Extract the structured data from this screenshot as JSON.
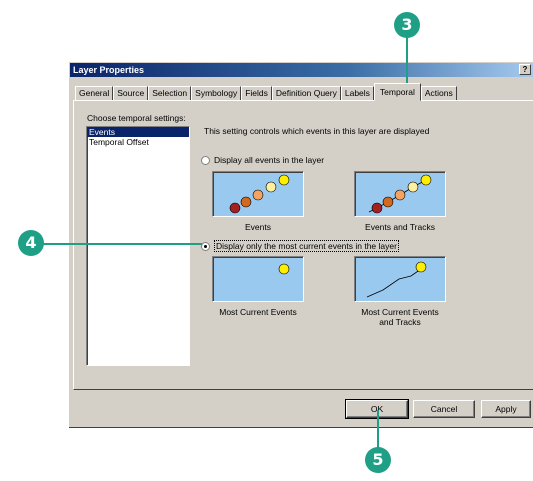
{
  "window": {
    "title": "Layer Properties",
    "help_label": "?"
  },
  "tabs": [
    {
      "label": "General"
    },
    {
      "label": "Source"
    },
    {
      "label": "Selection"
    },
    {
      "label": "Symbology"
    },
    {
      "label": "Fields"
    },
    {
      "label": "Definition Query"
    },
    {
      "label": "Labels"
    },
    {
      "label": "Temporal",
      "active": true
    },
    {
      "label": "Actions"
    }
  ],
  "panel": {
    "choose_label": "Choose temporal settings:",
    "list_items": [
      "Events",
      "Temporal Offset"
    ],
    "selected_item": "Events",
    "description": "This setting controls which events in this layer are displayed",
    "option_all": "Display all events in the layer",
    "option_current": "Display only the most current events in the layer",
    "selected_option": "current",
    "previews": {
      "events": "Events",
      "events_tracks": "Events and Tracks",
      "most_current": "Most Current Events",
      "most_current_tracks_line1": "Most Current Events",
      "most_current_tracks_line2": "and Tracks"
    }
  },
  "buttons": {
    "ok": "OK",
    "cancel": "Cancel",
    "apply": "Apply"
  },
  "callouts": [
    "3",
    "4",
    "5"
  ],
  "colors": {
    "callout": "#1e9f86",
    "preview_bg": "#9ac9f0",
    "title_bar": "#0a246a",
    "event_dots": [
      "#a52020",
      "#d2691e",
      "#f4a460",
      "#fff0a0",
      "#ffee00"
    ]
  }
}
